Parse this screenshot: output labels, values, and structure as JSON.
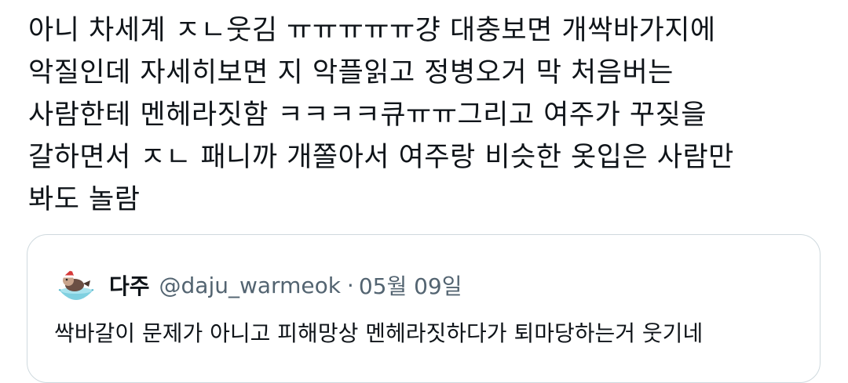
{
  "tweet": {
    "lines": [
      "아니 차세계 ㅈㄴ웃김 ㅠㅠㅠㅠㅠ걍 대충보면 개싹바가지에",
      "악질인데 자세히보면 지 악플읽고 정병오거 막 처음버는",
      "사람한테 멘헤라짓함 ㅋㅋㅋㅋ큐ㅠㅠ그리고 여주가 꾸짖을",
      "갈하면서 ㅈㄴ 패니까 개쫄아서 여주랑 비슷한 옷입은 사람만",
      "봐도 놀람"
    ]
  },
  "quoted_tweet": {
    "avatar_icon": "avatar-bird-in-bowl-icon",
    "display_name": "다주",
    "handle": "@daju_warmeok",
    "separator": "·",
    "date": "05월 09일",
    "text": "싹바갈이 문제가 아니고 피해망상 멘헤라짓하다가 퇴마당하는거 웃기네"
  },
  "colors": {
    "text_primary": "#0f1419",
    "text_secondary": "#536471",
    "card_border": "#cfd9de",
    "background": "#ffffff"
  }
}
